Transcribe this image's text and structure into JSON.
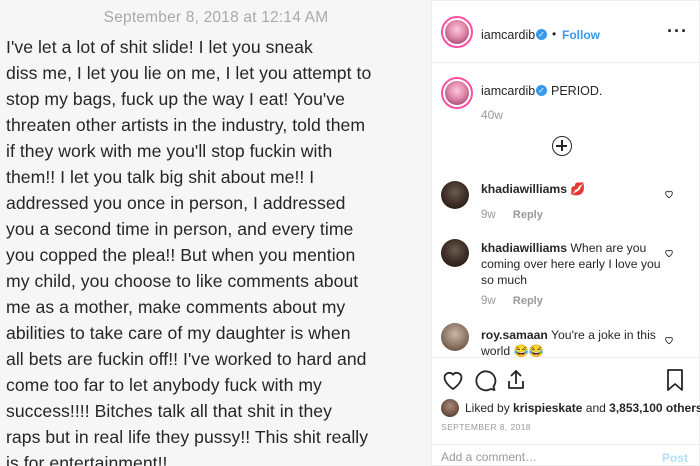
{
  "note": {
    "date": "September 8, 2018 at 12:14 AM",
    "body": "I've let a lot of shit slide! I let you sneak\ndiss me, I let you lie on me, I let you attempt to\nstop my bags, fuck up the way I eat! You've\nthreaten other artists in the industry, told them\nif they work with me you'll stop fuckin with\nthem!! I let you talk big shit about me!! I\naddressed you once in person, I addressed\nyou a second time in person, and every time\nyou copped the plea!! But when you mention\nmy child, you choose to like comments about\nme as a mother, make comments about my\nabilities to take care of my daughter is when\nall bets are fuckin off!! I've worked to hard and\ncome too far to let anybody fuck with my\nsuccess!!!! Bitches talk all that shit in they\nraps but in real life they pussy!! This shit really\nis for entertainment!!"
  },
  "header": {
    "username": "iamcardib",
    "follow_label": "Follow",
    "dot": "•",
    "more_label": "···"
  },
  "caption": {
    "username": "iamcardib",
    "text": "PERIOD.",
    "time": "40w"
  },
  "comments": [
    {
      "username": "khadiawilliams",
      "text": "💋",
      "time": "9w",
      "reply_label": "Reply"
    },
    {
      "username": "khadiawilliams",
      "text": "When are you coming over here early I love you so much",
      "time": "9w",
      "reply_label": "Reply"
    },
    {
      "username": "roy.samaan",
      "text": "You're a joke in this world 😂😂"
    }
  ],
  "likes": {
    "prefix": "Liked by",
    "user": "krispieskate",
    "middle": "and",
    "count": "3,853,100 others"
  },
  "post_date": "SEPTEMBER 8, 2018",
  "add_comment": {
    "placeholder": "Add a comment…",
    "post_label": "Post"
  },
  "icons": [
    "verified-badge-icon",
    "more-options-icon",
    "load-more-icon",
    "heart-icon",
    "comment-icon",
    "share-icon",
    "bookmark-icon"
  ],
  "colors": {
    "link_blue": "#3897f0",
    "muted": "#999999",
    "post_disabled": "#b2dffc",
    "avatar_ring": "#ff4fa3"
  }
}
